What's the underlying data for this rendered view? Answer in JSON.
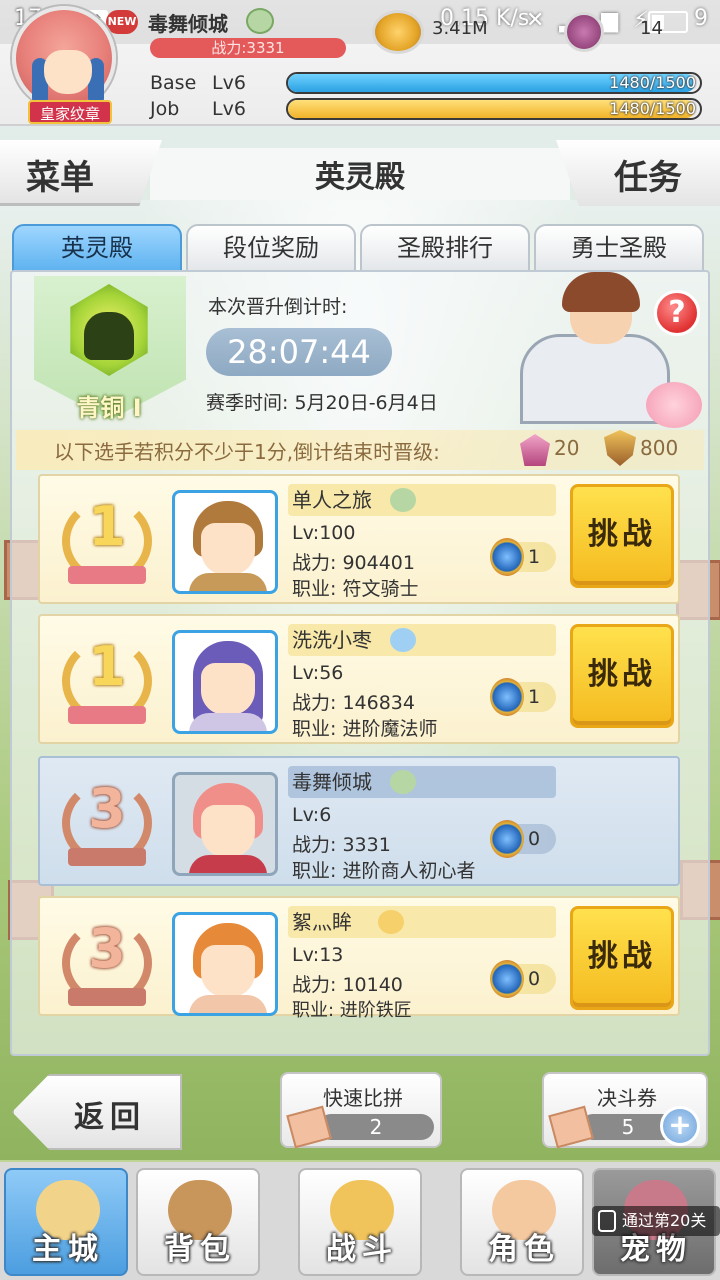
{
  "statusbar": {
    "time": "17:52",
    "upload_icon": "upload-icon",
    "new_badge": "NEW",
    "speed": "0.15 K/s",
    "battery_level": "9"
  },
  "hud": {
    "player_name": "毒舞倾城",
    "power": "战力:3331",
    "royal_badge": "皇家纹章",
    "coins": "3.41M",
    "gems": "14",
    "base_label": "Base",
    "base_level": "Lv6",
    "base_exp": "1480/1500",
    "base_exp_ratio": 0.987,
    "job_label": "Job",
    "job_level": "Lv6",
    "job_exp": "1480/1500",
    "job_exp_ratio": 0.987
  },
  "titlebar": {
    "menu": "菜单",
    "title": "英灵殿",
    "task": "任务"
  },
  "tabs": [
    {
      "label": "英灵殿",
      "active": true
    },
    {
      "label": "段位奖励",
      "active": false
    },
    {
      "label": "圣殿排行",
      "active": false
    },
    {
      "label": "勇士圣殿",
      "active": false
    }
  ],
  "rank": {
    "name": "青铜 I",
    "countdown_label": "本次晋升倒计时:",
    "countdown": "28:07:44",
    "season": "赛季时间: 5月20日-6月4日",
    "promo": "以下选手若积分不少于1分,倒计结束时晋级:",
    "gem_reward": "20",
    "shield_reward": "800"
  },
  "players": [
    {
      "rank": "1",
      "name": "单人之旅",
      "level": "Lv:100",
      "power": "战力: 904401",
      "job": "职业: 符文骑士",
      "tickets": "1",
      "challenge": "挑战",
      "self": false
    },
    {
      "rank": "1",
      "name": "洗洗小枣",
      "level": "Lv:56",
      "power": "战力: 146834",
      "job": "职业: 进阶魔法师",
      "tickets": "1",
      "challenge": "挑战",
      "self": false
    },
    {
      "rank": "3",
      "name": "毒舞倾城",
      "level": "Lv:6",
      "power": "战力: 3331",
      "job": "职业: 进阶商人初心者",
      "tickets": "0",
      "challenge": "",
      "self": true
    },
    {
      "rank": "3",
      "name": "絮灬眸",
      "level": "Lv:13",
      "power": "战力: 10140",
      "job": "职业: 进阶铁匠",
      "tickets": "0",
      "challenge": "挑战",
      "self": false
    }
  ],
  "controls": {
    "back": "返回",
    "quick_compete": "快速比拼",
    "quick_count": "2",
    "duel_ticket": "决斗券",
    "duel_count": "5",
    "plus": "+"
  },
  "nav": [
    {
      "label": "主城",
      "icon": "castle-icon"
    },
    {
      "label": "背包",
      "icon": "backpack-icon"
    },
    {
      "label": "战斗",
      "icon": "crossed-swords-icon"
    },
    {
      "label": "角色",
      "icon": "character-icon"
    },
    {
      "label": "宠物",
      "icon": "pet-icon"
    }
  ],
  "lock_tip": "通过第20关",
  "colors": {
    "tab_active": "#5fb3f0",
    "challenge": "#f4ba1f",
    "base_exp": "#2aa0e2",
    "job_exp": "#f1b32a",
    "power_bar": "#e45a5a"
  }
}
